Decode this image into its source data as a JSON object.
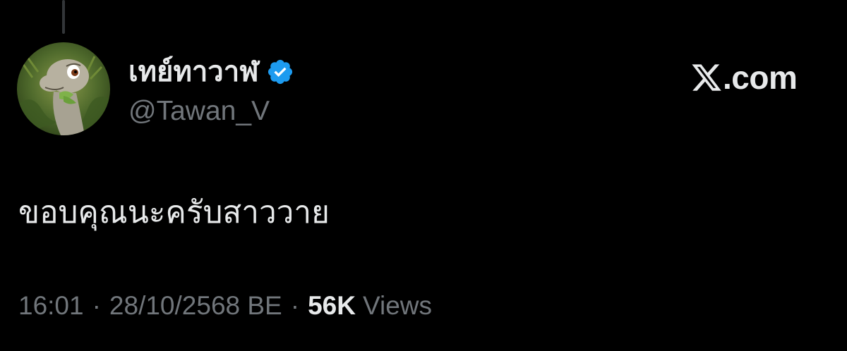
{
  "tweet": {
    "author": {
      "display_name": "เทย์ทาวาฬ",
      "handle": "@Tawan_V",
      "verified": true,
      "avatar": "cartoon-dinosaur-avatar"
    },
    "brand": {
      "icon": "x-logo-icon",
      "domain": ".com"
    },
    "text": "ขอบคุณนะครับสาววาย",
    "meta": {
      "time": "16:01",
      "date": "28/10/2568 BE",
      "separator": "·",
      "views_count": "56K",
      "views_label": "Views"
    }
  },
  "colors": {
    "background": "#000000",
    "primary_text": "#e7e9ea",
    "secondary_text": "#71767b",
    "verified_badge": "#1d9bf0"
  }
}
